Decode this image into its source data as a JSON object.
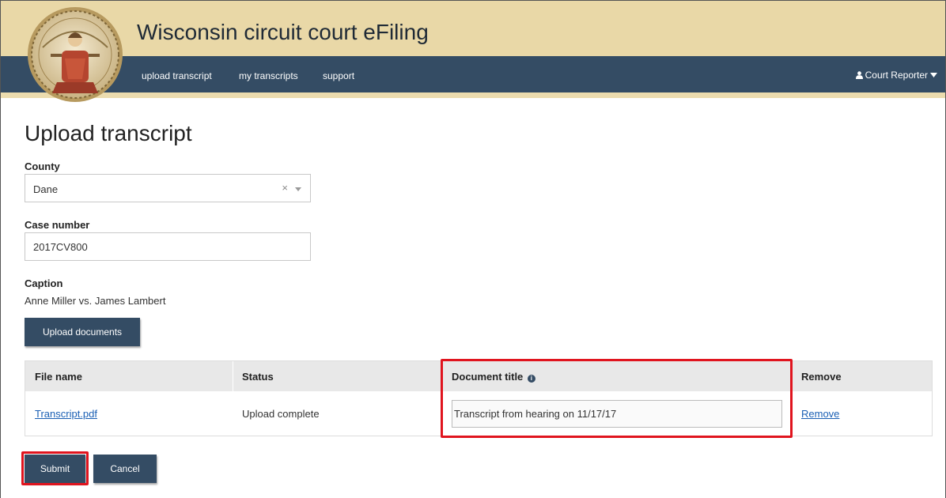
{
  "app": {
    "title": "Wisconsin circuit court eFiling",
    "logo_icon": "court-seal-icon"
  },
  "nav": {
    "items": [
      {
        "label": "upload transcript"
      },
      {
        "label": "my transcripts"
      },
      {
        "label": "support"
      }
    ],
    "user": {
      "label": "Court Reporter",
      "icon": "user-icon",
      "caret_icon": "caret-down-icon"
    }
  },
  "page": {
    "title": "Upload transcript"
  },
  "form": {
    "county": {
      "label": "County",
      "value": "Dane",
      "clear_glyph": "×"
    },
    "case_number": {
      "label": "Case number",
      "value": "2017CV800"
    },
    "caption": {
      "label": "Caption",
      "value": "Anne Miller vs. James Lambert"
    },
    "upload_button": "Upload documents"
  },
  "table": {
    "headers": [
      "File name",
      "Status",
      "Document title",
      "Remove"
    ],
    "rows": [
      {
        "file_name": "Transcript.pdf",
        "status": "Upload complete",
        "document_title": "Transcript from hearing on 11/17/17",
        "remove": "Remove"
      }
    ]
  },
  "actions": {
    "submit": "Submit",
    "cancel": "Cancel"
  },
  "colors": {
    "header_band": "#e9d8a7",
    "navbar": "#344c64",
    "button": "#344c64",
    "highlight": "#e0141e",
    "link": "#1a5fb4"
  }
}
